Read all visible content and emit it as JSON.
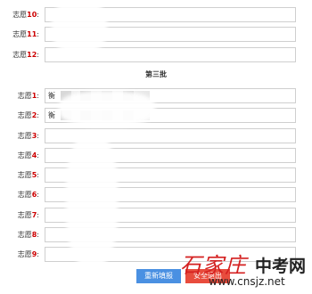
{
  "section_title": "第三批",
  "label_prefix": "志愿",
  "top_rows": [
    {
      "num": "10",
      "value": ""
    },
    {
      "num": "11",
      "value": ""
    },
    {
      "num": "12",
      "value": ""
    }
  ],
  "batch3_rows": [
    {
      "num": "1",
      "value": "衡"
    },
    {
      "num": "2",
      "value": "衡"
    },
    {
      "num": "3",
      "value": ""
    },
    {
      "num": "4",
      "value": ""
    },
    {
      "num": "5",
      "value": ""
    },
    {
      "num": "6",
      "value": ""
    },
    {
      "num": "7",
      "value": ""
    },
    {
      "num": "8",
      "value": ""
    },
    {
      "num": "9",
      "value": ""
    }
  ],
  "buttons": {
    "reset": "重新填报",
    "exit": "安全退出"
  },
  "watermark": {
    "cn": "石家庄",
    "site": "中考网",
    "url": "www.cnsjz.net"
  }
}
